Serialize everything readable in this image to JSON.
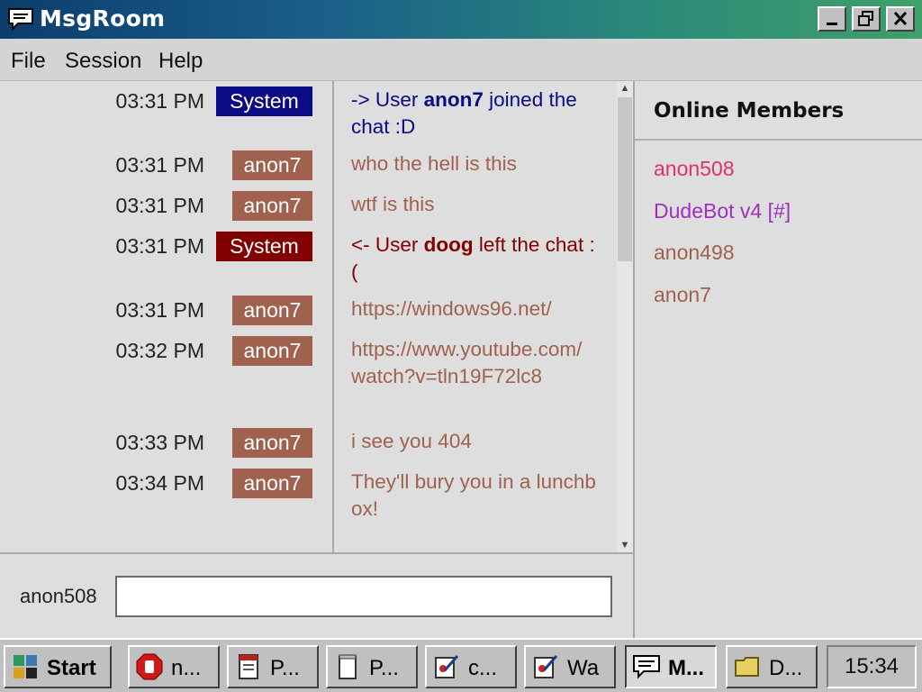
{
  "window": {
    "title": "MsgRoom"
  },
  "menu": {
    "items": [
      "File",
      "Session",
      "Help"
    ]
  },
  "messages": [
    {
      "time": "03:31 PM",
      "user": "System",
      "kind": "sys-blue",
      "pre": "-> User ",
      "bold": "anon7",
      "post": " joined the chat :D"
    },
    {
      "time": "03:31 PM",
      "user": "anon7",
      "kind": "user",
      "text": "who the hell is this"
    },
    {
      "time": "03:31 PM",
      "user": "anon7",
      "kind": "user",
      "text": "wtf is this"
    },
    {
      "time": "03:31 PM",
      "user": "System",
      "kind": "sys-red",
      "pre": "<- User ",
      "bold": "doog",
      "post": " left the chat :("
    },
    {
      "time": "03:31 PM",
      "user": "anon7",
      "kind": "user",
      "text": "https://windows96.net/"
    },
    {
      "time": "03:32 PM",
      "user": "anon7",
      "kind": "user",
      "text": "https://www.youtube.com/watch?v=tln19F72lc8"
    },
    {
      "time": "03:33 PM",
      "user": "anon7",
      "kind": "user",
      "text": "i see you 404"
    },
    {
      "time": "03:34 PM",
      "user": "anon7",
      "kind": "user",
      "text": "They'll bury you in a lunchbox!"
    }
  ],
  "members": {
    "heading": "Online Members",
    "list": [
      {
        "name": "anon508",
        "color": "#e0306a"
      },
      {
        "name": "DudeBot v4 [#]",
        "color": "#a030c0"
      },
      {
        "name": "anon498",
        "color": "#a0614e"
      },
      {
        "name": "anon7",
        "color": "#a0614e"
      }
    ]
  },
  "input": {
    "label": "anon508",
    "value": ""
  },
  "taskbar": {
    "start": "Start",
    "buttons": [
      {
        "label": "n...",
        "icon": "stop-icon"
      },
      {
        "label": "P...",
        "icon": "document-icon"
      },
      {
        "label": "P...",
        "icon": "notepad-icon"
      },
      {
        "label": "c...",
        "icon": "paint-icon"
      },
      {
        "label": "Wa",
        "icon": "paint-icon"
      },
      {
        "label": "M...",
        "icon": "chat-icon",
        "active": true
      },
      {
        "label": "D...",
        "icon": "folder-icon"
      }
    ],
    "clock": "15:34"
  }
}
